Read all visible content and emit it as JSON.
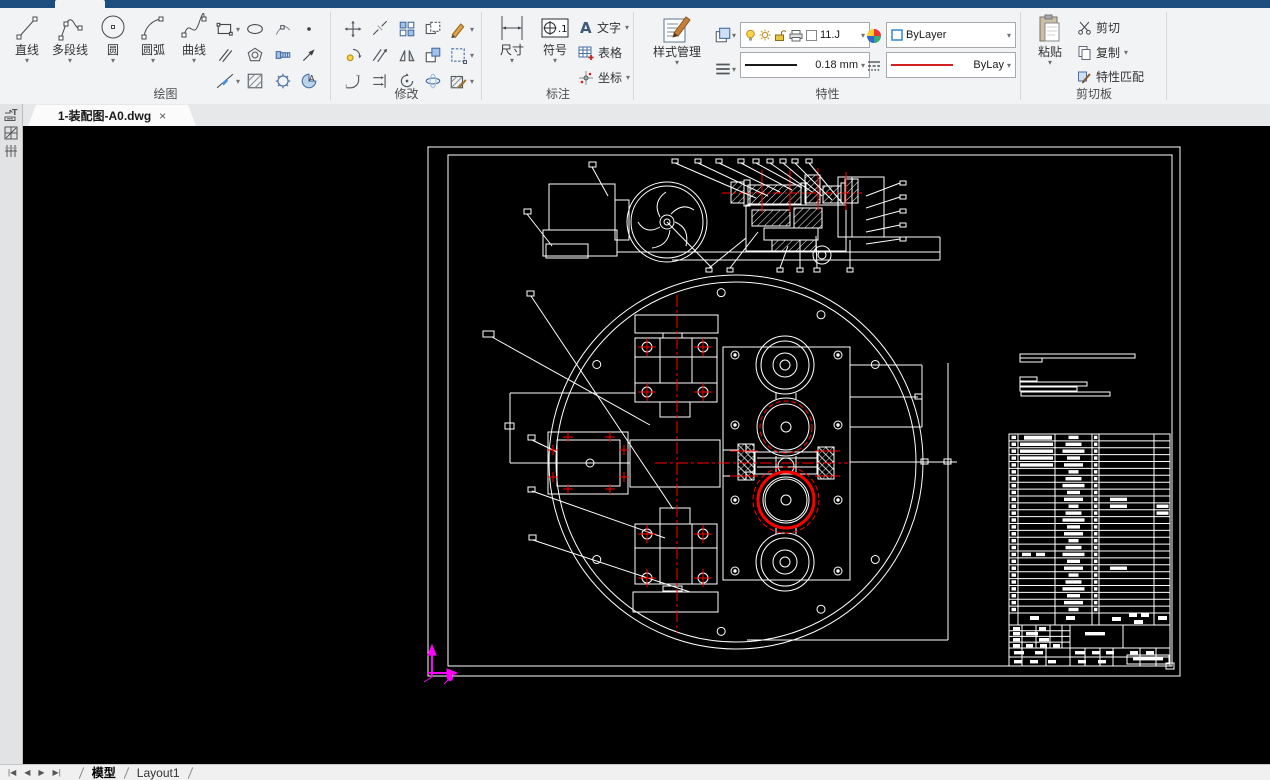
{
  "app": {
    "accent_blue": "#1d4e7f",
    "canvas_bg": "#000000",
    "cad_line_color": "#ffffff",
    "cad_centerline_color": "#ff0000",
    "ucs_color": "#ff00ff"
  },
  "ribbon": {
    "groups": [
      {
        "id": "draw",
        "label": "绘图",
        "big_buttons": [
          "直线",
          "多段线",
          "圆",
          "圆弧",
          "曲线"
        ]
      },
      {
        "id": "modify",
        "label": "修改"
      },
      {
        "id": "annotate",
        "label": "标注",
        "big_buttons": [
          "尺寸",
          "符号"
        ],
        "side_buttons": [
          "文字",
          "表格",
          "坐标"
        ]
      },
      {
        "id": "properties",
        "label": "特性",
        "style_manager": "样式管理",
        "layer_value": "11.J",
        "color_value": "ByLayer",
        "lineweight_value": "0.18 mm",
        "linetype_value": "ByLay"
      },
      {
        "id": "clipboard",
        "label": "剪切板",
        "paste": "粘贴",
        "items": [
          "剪切",
          "复制",
          "特性匹配"
        ]
      }
    ]
  },
  "document_tab": {
    "title": "1-装配图-A0.dwg",
    "close": "×"
  },
  "status_bar": {
    "nav": [
      "|◀",
      "◀",
      "▶",
      "▶|"
    ],
    "model_tab": "模型",
    "layout_tab": "Layout1"
  }
}
